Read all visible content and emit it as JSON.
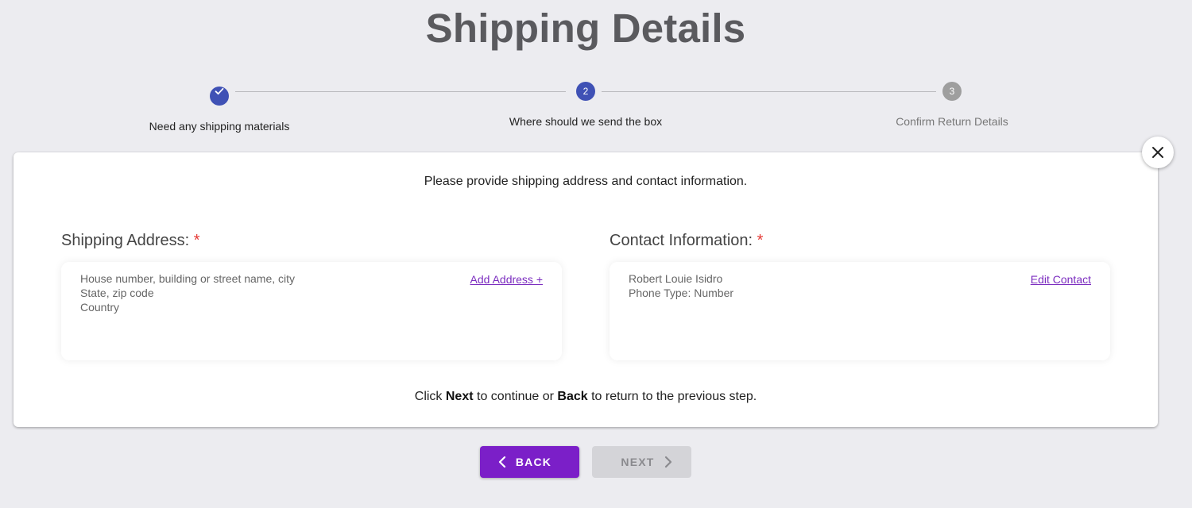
{
  "header": {
    "title": "Shipping Details"
  },
  "stepper": {
    "steps": [
      {
        "label": "Need any shipping materials",
        "number": "",
        "state": "done"
      },
      {
        "label": "Where should we send the box",
        "number": "2",
        "state": "active"
      },
      {
        "label": "Confirm Return Details",
        "number": "3",
        "state": "pending"
      }
    ]
  },
  "card": {
    "intro": "Please provide shipping address and contact information.",
    "shipping": {
      "label": "Shipping Address:",
      "required_mark": "*",
      "lines": [
        "House number, building or street name, city",
        "State, zip code",
        "Country"
      ],
      "action": "Add Address +"
    },
    "contact": {
      "label": "Contact Information:",
      "required_mark": "*",
      "lines": [
        "Robert Louie Isidro",
        "Phone Type: Number"
      ],
      "action": "Edit Contact"
    },
    "hint": {
      "pre": "Click ",
      "next_word": "Next",
      "mid": " to continue or ",
      "back_word": "Back",
      "post": " to return to the previous step."
    }
  },
  "nav": {
    "back_label": "BACK",
    "next_label": "NEXT"
  },
  "colors": {
    "accent": "#7b1fc8",
    "step_active": "#3f51b5",
    "step_pending": "#9e9e9e",
    "link": "#7b2cbf",
    "required": "#e53935"
  },
  "icons": {
    "close": "close-icon",
    "check": "check-icon",
    "back": "chevron-left-icon",
    "next": "chevron-right-icon"
  }
}
